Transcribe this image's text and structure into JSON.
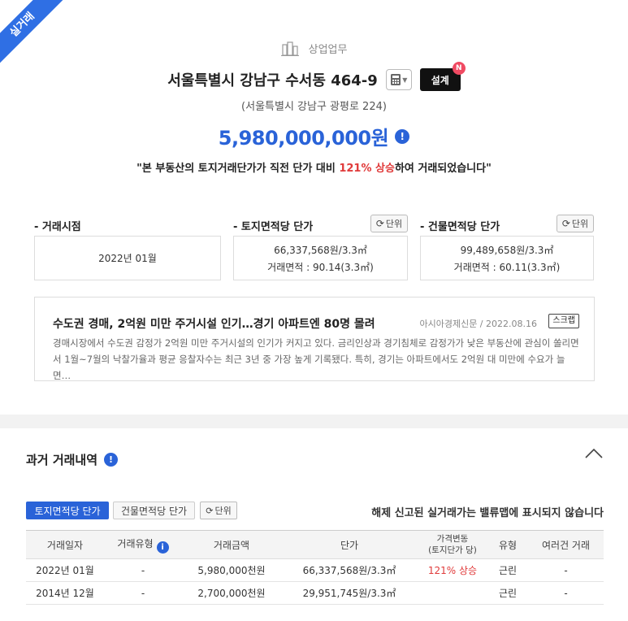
{
  "ribbon": "실거래",
  "category": "상업업무",
  "address": "서울특별시 강남구 수서동 464-9",
  "design_label": "설계",
  "new_badge": "N",
  "road_address": "(서울특별시 강남구 광평로 224)",
  "price": "5,980,000,000원",
  "description": {
    "prefix": "\"본 부동산의 토지거래단가가 직전 단가 대비 ",
    "highlight": "121% 상승",
    "suffix": "하여 거래되었습니다\""
  },
  "metrics": {
    "date_label": "- 거래시점",
    "date_value": "2022년 01월",
    "land_label": "- 토지면적당 단가",
    "land_value": "66,337,568원/3.3㎡",
    "land_area": "거래면적 : 90.14(3.3㎡)",
    "building_label": "- 건물면적당 단가",
    "building_value": "99,489,658원/3.3㎡",
    "building_area": "거래면적 : 60.11(3.3㎡)",
    "unit_label": "단위"
  },
  "news": {
    "title": "수도권 경매, 2억원 미만 주거시설 인기…경기 아파트엔 80명 몰려",
    "source": "아시아경제신문 / 2022.08.16",
    "scrap_label": "스크랩",
    "body": "경매시장에서 수도권 감정가 2억원 미만 주거시설의 인기가 커지고 있다. 금리인상과 경기침체로 감정가가 낮은 부동산에 관심이 쏠리면서 1월~7월의 낙찰가율과 평균 응찰자수는 최근 3년 중 가장 높게 기록됐다. 특히, 경기는 아파트에서도 2억원 대 미만에 수요가 늘면…"
  },
  "history": {
    "title": "과거 거래내역",
    "tab_land": "토지면적당 단가",
    "tab_building": "건물면적당 단가",
    "tab_unit": "단위",
    "notice": "해제 신고된 실거래가는 밸류맵에 표시되지 않습니다",
    "columns": [
      "거래일자",
      "거래유형",
      "거래금액",
      "단가",
      "가격변동",
      "(토지단가 당)",
      "유형",
      "여러건 거래"
    ],
    "rows": [
      [
        "2022년 01월",
        "-",
        "5,980,000천원",
        "66,337,568원/3.3㎡",
        "121% 상승",
        "근린",
        "-"
      ],
      [
        "2014년 12월",
        "-",
        "2,700,000천원",
        "29,951,745원/3.3㎡",
        "",
        "근린",
        "-"
      ]
    ]
  },
  "colors": {
    "accent": "#2a63d8",
    "up": "#e03a3a",
    "ribbon": "#2f6fe4"
  }
}
